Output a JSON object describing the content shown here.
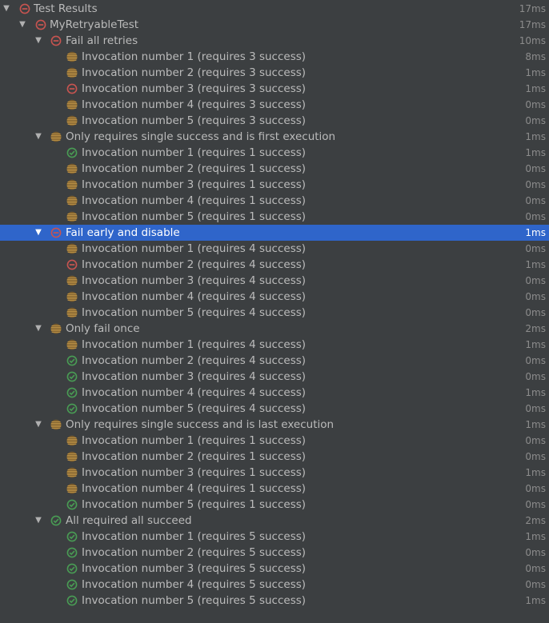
{
  "colors": {
    "background": "#3c3f41",
    "selection": "#2f65ca",
    "text": "#bbbbbb",
    "time": "#8c8c8c",
    "failed": "#c75450",
    "passed": "#499c54",
    "ignored": "#c09548"
  },
  "root": {
    "label": "Test Results",
    "time": "17ms",
    "status": "failed",
    "expanded": true
  },
  "suite": {
    "label": "MyRetryableTest",
    "time": "17ms",
    "status": "failed",
    "expanded": true
  },
  "groups": [
    {
      "label": "Fail all retries",
      "time": "10ms",
      "status": "failed",
      "expanded": true,
      "selected": false,
      "items": [
        {
          "label": "Invocation number 1 (requires 3 success)",
          "time": "8ms",
          "status": "ignored"
        },
        {
          "label": "Invocation number 2 (requires 3 success)",
          "time": "1ms",
          "status": "ignored"
        },
        {
          "label": "Invocation number 3 (requires 3 success)",
          "time": "1ms",
          "status": "failed"
        },
        {
          "label": "Invocation number 4 (requires 3 success)",
          "time": "0ms",
          "status": "ignored"
        },
        {
          "label": "Invocation number 5 (requires 3 success)",
          "time": "0ms",
          "status": "ignored"
        }
      ]
    },
    {
      "label": "Only requires single success and is first execution",
      "time": "1ms",
      "status": "ignored",
      "expanded": true,
      "selected": false,
      "items": [
        {
          "label": "Invocation number 1 (requires 1 success)",
          "time": "1ms",
          "status": "passed"
        },
        {
          "label": "Invocation number 2 (requires 1 success)",
          "time": "0ms",
          "status": "ignored"
        },
        {
          "label": "Invocation number 3 (requires 1 success)",
          "time": "0ms",
          "status": "ignored"
        },
        {
          "label": "Invocation number 4 (requires 1 success)",
          "time": "0ms",
          "status": "ignored"
        },
        {
          "label": "Invocation number 5 (requires 1 success)",
          "time": "0ms",
          "status": "ignored"
        }
      ]
    },
    {
      "label": "Fail early and disable",
      "time": "1ms",
      "status": "failed",
      "expanded": true,
      "selected": true,
      "items": [
        {
          "label": "Invocation number 1 (requires 4 success)",
          "time": "0ms",
          "status": "ignored"
        },
        {
          "label": "Invocation number 2 (requires 4 success)",
          "time": "1ms",
          "status": "failed"
        },
        {
          "label": "Invocation number 3 (requires 4 success)",
          "time": "0ms",
          "status": "ignored"
        },
        {
          "label": "Invocation number 4 (requires 4 success)",
          "time": "0ms",
          "status": "ignored"
        },
        {
          "label": "Invocation number 5 (requires 4 success)",
          "time": "0ms",
          "status": "ignored"
        }
      ]
    },
    {
      "label": "Only fail once",
      "time": "2ms",
      "status": "ignored",
      "expanded": true,
      "selected": false,
      "items": [
        {
          "label": "Invocation number 1 (requires 4 success)",
          "time": "1ms",
          "status": "ignored"
        },
        {
          "label": "Invocation number 2 (requires 4 success)",
          "time": "0ms",
          "status": "passed"
        },
        {
          "label": "Invocation number 3 (requires 4 success)",
          "time": "0ms",
          "status": "passed"
        },
        {
          "label": "Invocation number 4 (requires 4 success)",
          "time": "1ms",
          "status": "passed"
        },
        {
          "label": "Invocation number 5 (requires 4 success)",
          "time": "0ms",
          "status": "passed"
        }
      ]
    },
    {
      "label": "Only requires single success and is last execution",
      "time": "1ms",
      "status": "ignored",
      "expanded": true,
      "selected": false,
      "items": [
        {
          "label": "Invocation number 1 (requires 1 success)",
          "time": "0ms",
          "status": "ignored"
        },
        {
          "label": "Invocation number 2 (requires 1 success)",
          "time": "0ms",
          "status": "ignored"
        },
        {
          "label": "Invocation number 3 (requires 1 success)",
          "time": "1ms",
          "status": "ignored"
        },
        {
          "label": "Invocation number 4 (requires 1 success)",
          "time": "0ms",
          "status": "ignored"
        },
        {
          "label": "Invocation number 5 (requires 1 success)",
          "time": "0ms",
          "status": "passed"
        }
      ]
    },
    {
      "label": "All required all succeed",
      "time": "2ms",
      "status": "passed",
      "expanded": true,
      "selected": false,
      "items": [
        {
          "label": "Invocation number 1 (requires 5 success)",
          "time": "1ms",
          "status": "passed"
        },
        {
          "label": "Invocation number 2 (requires 5 success)",
          "time": "0ms",
          "status": "passed"
        },
        {
          "label": "Invocation number 3 (requires 5 success)",
          "time": "0ms",
          "status": "passed"
        },
        {
          "label": "Invocation number 4 (requires 5 success)",
          "time": "0ms",
          "status": "passed"
        },
        {
          "label": "Invocation number 5 (requires 5 success)",
          "time": "1ms",
          "status": "passed"
        }
      ]
    }
  ]
}
